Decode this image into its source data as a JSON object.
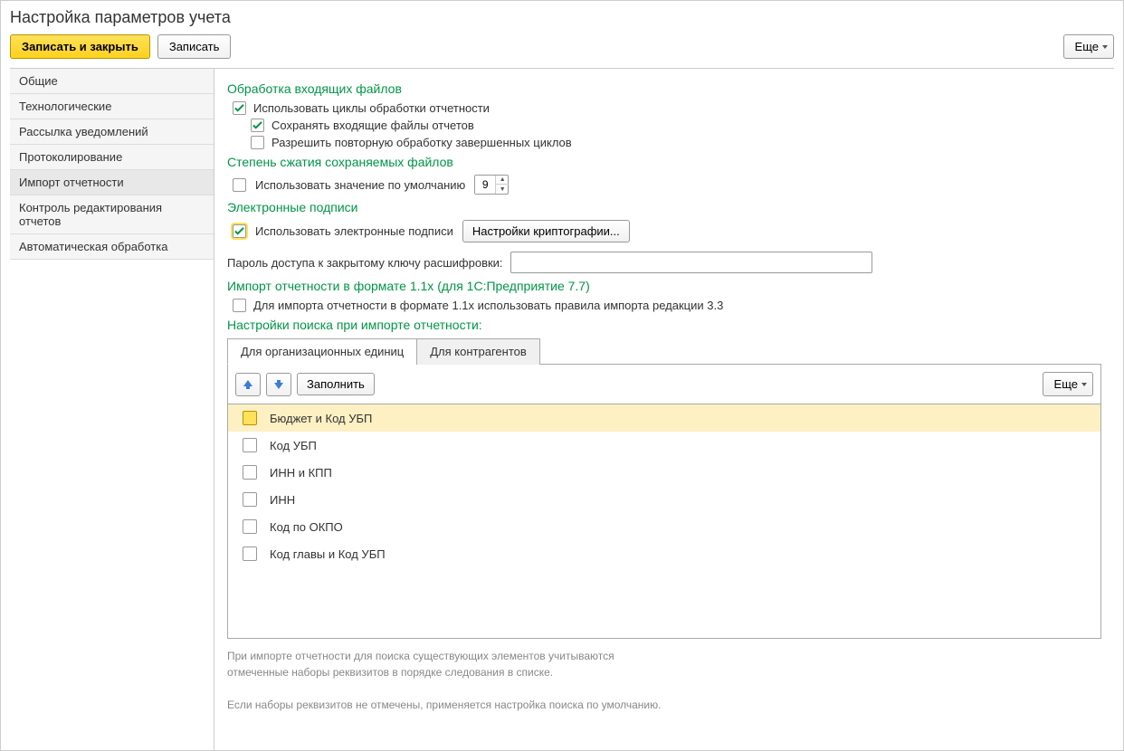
{
  "title": "Настройка параметров учета",
  "toolbar": {
    "save_close": "Записать и закрыть",
    "save": "Записать",
    "more": "Еще"
  },
  "sidebar": {
    "items": [
      {
        "label": "Общие"
      },
      {
        "label": "Технологические"
      },
      {
        "label": "Рассылка уведомлений"
      },
      {
        "label": "Протоколирование"
      },
      {
        "label": "Импорт отчетности"
      },
      {
        "label": "Контроль редактирования отчетов"
      },
      {
        "label": "Автоматическая обработка"
      }
    ]
  },
  "sections": {
    "incoming": {
      "title": "Обработка входящих файлов",
      "use_cycles": "Использовать циклы обработки отчетности",
      "save_files": "Сохранять входящие файлы отчетов",
      "allow_reprocess": "Разрешить повторную обработку завершенных циклов"
    },
    "compression": {
      "title": "Степень сжатия сохраняемых файлов",
      "use_default": "Использовать значение по умолчанию",
      "value": "9"
    },
    "signatures": {
      "title": "Электронные подписи",
      "use_signatures": "Использовать электронные подписи",
      "crypto_settings": "Настройки криптографии...",
      "password_label": "Пароль доступа к закрытому ключу расшифровки:"
    },
    "import": {
      "title": "Импорт отчетности в формате 1.1x (для 1С:Предприятие 7.7)",
      "use_rules": "Для импорта отчетности в формате 1.1x использовать правила импорта редакции 3.3"
    },
    "search_settings": {
      "title": "Настройки поиска при импорте отчетности:",
      "tabs": [
        "Для организационных единиц",
        "Для контрагентов"
      ],
      "fill_btn": "Заполнить",
      "more": "Еще",
      "items": [
        "Бюджет и Код УБП",
        "Код УБП",
        "ИНН и КПП",
        "ИНН",
        "Код по ОКПО",
        "Код главы и Код УБП"
      ],
      "footnote1": "При импорте отчетности для поиска существующих элементов учитываются",
      "footnote2": "отмеченные наборы реквизитов в порядке следования в списке.",
      "footnote3": "Если наборы реквизитов не отмечены, применяется настройка поиска по умолчанию."
    }
  }
}
